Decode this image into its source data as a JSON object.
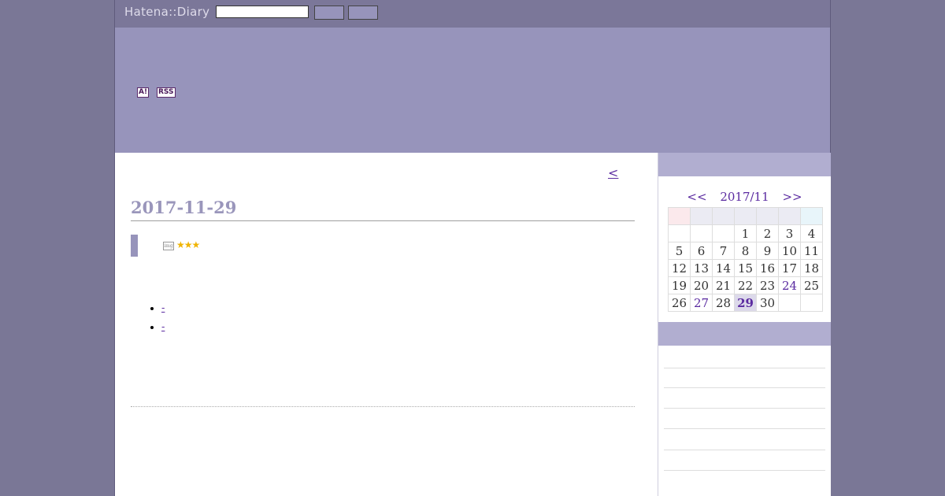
{
  "header": {
    "logo": "Hatena::Diary",
    "search_value": "",
    "button1_label": "",
    "button2_label": ""
  },
  "banner": {
    "badge_a": "A!",
    "badge_rss": "RSS"
  },
  "main": {
    "prev_link": "<",
    "date": "2017-11-29",
    "entries": [
      "-",
      "-"
    ]
  },
  "calendar": {
    "prev": "<<",
    "month": "2017/11",
    "next": ">>",
    "weeks": [
      [
        "",
        "",
        "",
        "1",
        "2",
        "3",
        "4"
      ],
      [
        "5",
        "6",
        "7",
        "8",
        "9",
        "10",
        "11"
      ],
      [
        "12",
        "13",
        "14",
        "15",
        "16",
        "17",
        "18"
      ],
      [
        "19",
        "20",
        "21",
        "22",
        "23",
        "24",
        "25"
      ],
      [
        "26",
        "27",
        "28",
        "29",
        "30",
        "",
        ""
      ]
    ],
    "linked_days": [
      "24",
      "27"
    ],
    "today": "29"
  },
  "colors": {
    "accent": "#9794bb",
    "topbar": "#7b7799",
    "link": "#5a2aa0",
    "date": "#9a96bb"
  }
}
